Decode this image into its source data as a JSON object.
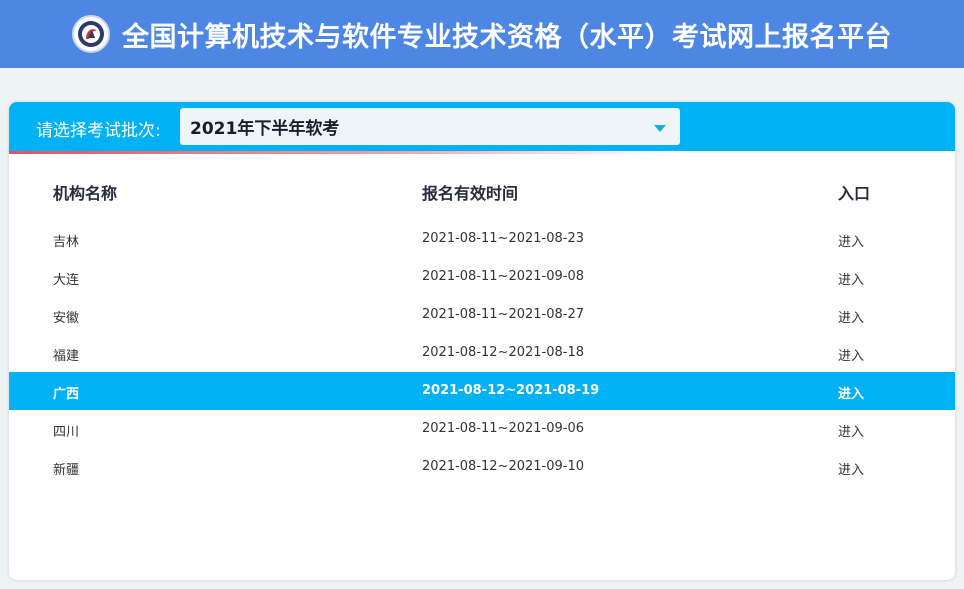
{
  "header": {
    "title": "全国计算机技术与软件专业技术资格（水平）考试网上报名平台"
  },
  "batch": {
    "label": "请选择考试批次:",
    "selected": "2021年下半年软考"
  },
  "table": {
    "columns": [
      "机构名称",
      "报名有效时间",
      "入口"
    ],
    "rows": [
      {
        "name": "吉林",
        "period": "2021-08-11~2021-08-23",
        "entry": "进入"
      },
      {
        "name": "大连",
        "period": "2021-08-11~2021-09-08",
        "entry": "进入"
      },
      {
        "name": "安徽",
        "period": "2021-08-11~2021-08-27",
        "entry": "进入"
      },
      {
        "name": "福建",
        "period": "2021-08-12~2021-08-18",
        "entry": "进入"
      },
      {
        "name": "广西",
        "period": "2021-08-12~2021-08-19",
        "entry": "进入"
      },
      {
        "name": "四川",
        "period": "2021-08-11~2021-09-06",
        "entry": "进入"
      },
      {
        "name": "新疆",
        "period": "2021-08-12~2021-09-10",
        "entry": "进入"
      }
    ]
  },
  "colors": {
    "header_bg": "#4d86e3",
    "accent": "#00b2f5",
    "underline": "#e8515a"
  }
}
